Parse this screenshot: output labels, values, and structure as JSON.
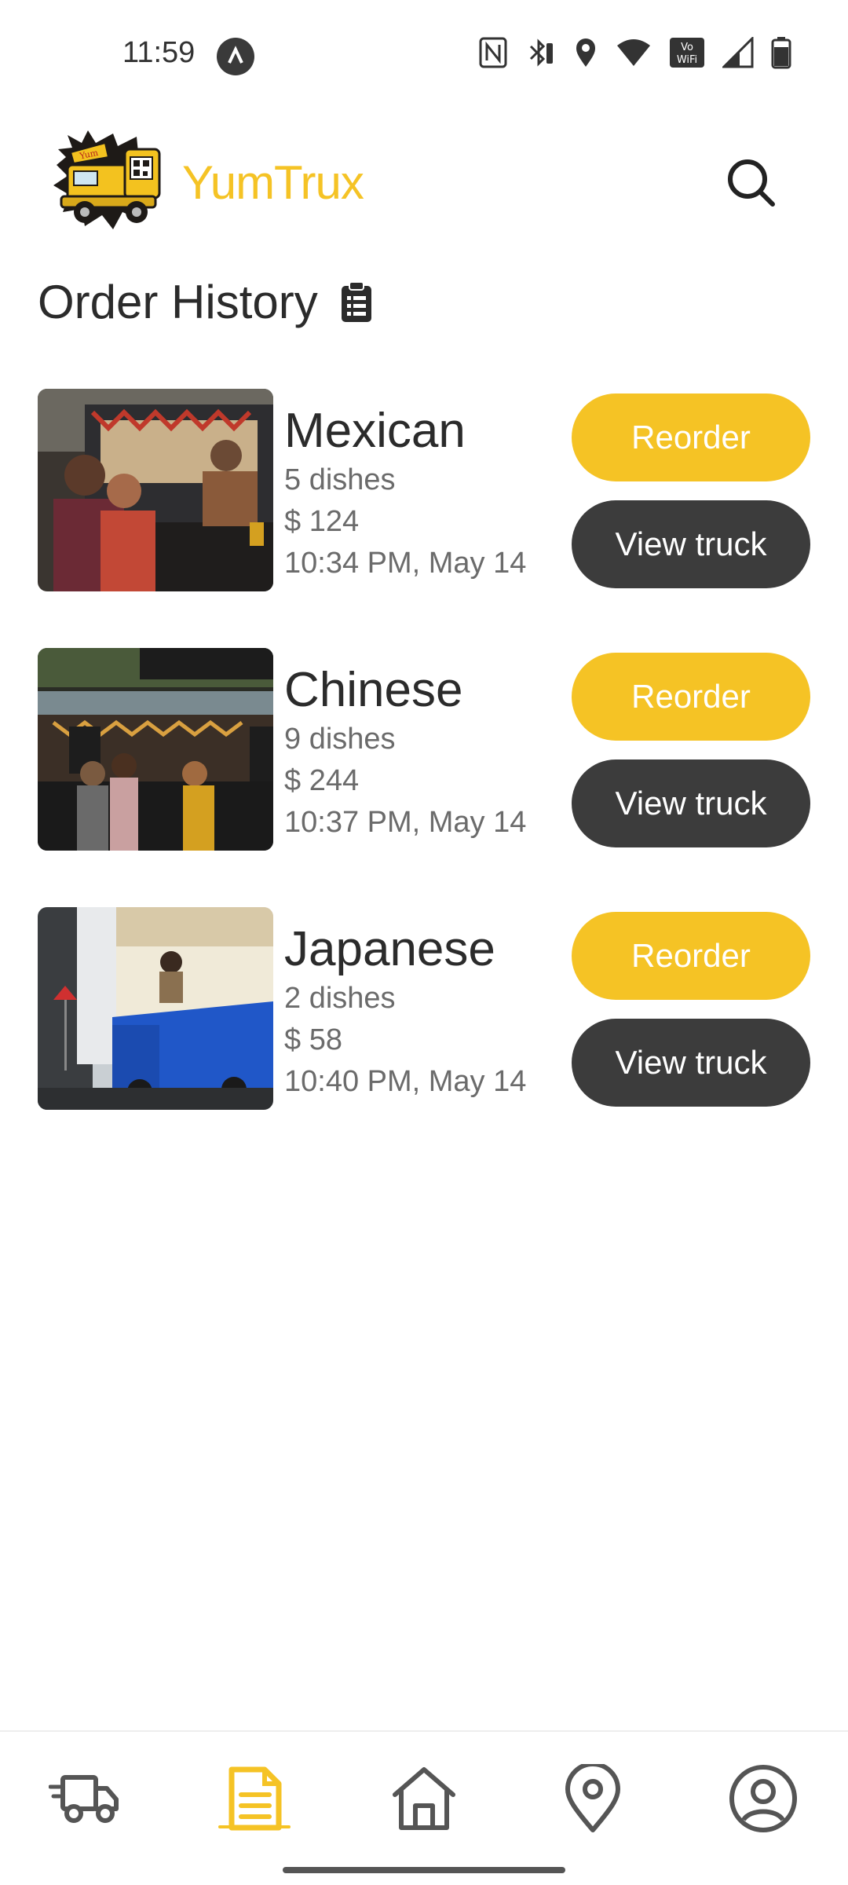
{
  "status_bar": {
    "time": "11:59"
  },
  "header": {
    "brand": "YumTrux",
    "logo_icon": "food-truck-logo",
    "search_icon": "search-icon"
  },
  "page": {
    "title": "Order History",
    "title_icon": "clipboard-icon"
  },
  "orders": [
    {
      "name": "Mexican",
      "dishes": "5 dishes",
      "price": "$ 124",
      "time": "10:34 PM, May 14",
      "reorder_label": "Reorder",
      "view_label": "View truck"
    },
    {
      "name": "Chinese",
      "dishes": "9 dishes",
      "price": "$ 244",
      "time": "10:37 PM, May 14",
      "reorder_label": "Reorder",
      "view_label": "View truck"
    },
    {
      "name": "Japanese",
      "dishes": "2 dishes",
      "price": "$ 58",
      "time": "10:40 PM, May 14",
      "reorder_label": "Reorder",
      "view_label": "View truck"
    }
  ],
  "bottom_nav": {
    "items": [
      "truck-icon",
      "orders-icon",
      "home-icon",
      "location-pin-icon",
      "profile-icon"
    ],
    "active_index": 1
  },
  "colors": {
    "accent": "#f5c325",
    "dark_button": "#3c3c3c",
    "text": "#2b2b2b",
    "muted": "#6b6b6b"
  }
}
